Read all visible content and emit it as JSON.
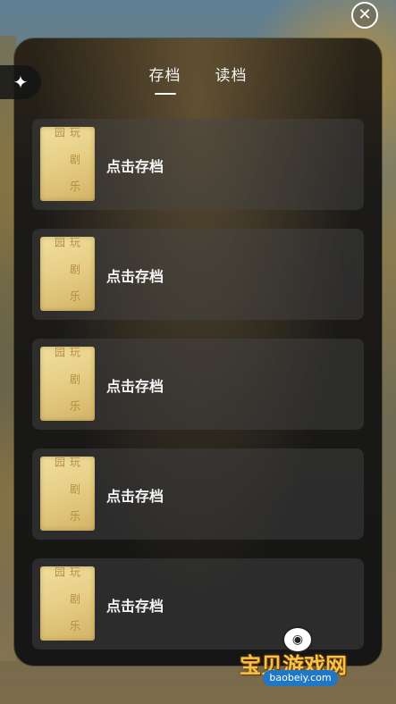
{
  "top": {
    "close_icon": "close-icon"
  },
  "panel": {
    "back_icon": "back-sparkle-icon",
    "tabs": [
      {
        "label": "存档",
        "active": true
      },
      {
        "label": "读档",
        "active": false
      }
    ],
    "slots": [
      {
        "thumbnail_text": "玩\n剧\n乐\n园",
        "label": "点击存档"
      },
      {
        "thumbnail_text": "玩\n剧\n乐\n园",
        "label": "点击存档"
      },
      {
        "thumbnail_text": "玩\n剧\n乐\n园",
        "label": "点击存档"
      },
      {
        "thumbnail_text": "玩\n剧\n乐\n园",
        "label": "点击存档"
      },
      {
        "thumbnail_text": "玩\n剧\n乐\n园",
        "label": "点击存档"
      }
    ]
  },
  "watermark": {
    "title": "宝贝游戏网",
    "url": "baobeiy.com"
  }
}
